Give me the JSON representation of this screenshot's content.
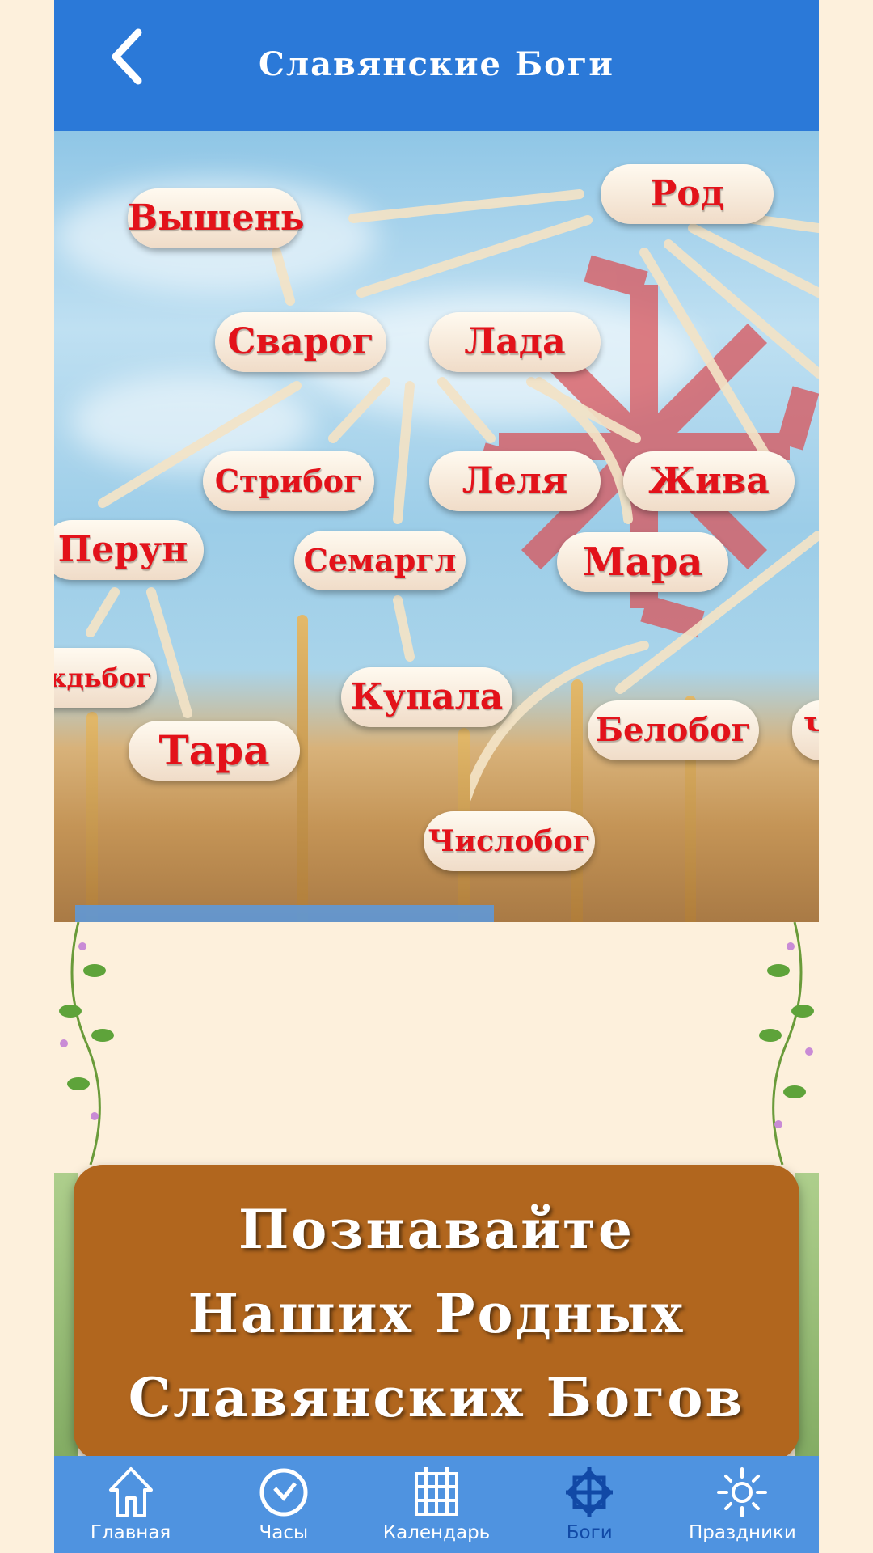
{
  "header": {
    "title": "Славянские Боги",
    "back_icon": "chevron-left-icon"
  },
  "gods": [
    {
      "id": "vyshen",
      "label": "Вышень"
    },
    {
      "id": "rod",
      "label": "Род"
    },
    {
      "id": "svarog",
      "label": "Сварог"
    },
    {
      "id": "lada",
      "label": "Лада"
    },
    {
      "id": "stribog",
      "label": "Стрибог"
    },
    {
      "id": "lelya",
      "label": "Леля"
    },
    {
      "id": "zhiva",
      "label": "Жива"
    },
    {
      "id": "perun",
      "label": "Перун"
    },
    {
      "id": "semargl",
      "label": "Семаргл"
    },
    {
      "id": "mara",
      "label": "Мара"
    },
    {
      "id": "dazhdbog",
      "label": "ждьбог"
    },
    {
      "id": "kupala",
      "label": "Купала"
    },
    {
      "id": "tara",
      "label": "Тара"
    },
    {
      "id": "belobog",
      "label": "Белобог"
    },
    {
      "id": "cut",
      "label": "Ч"
    },
    {
      "id": "chislobog",
      "label": "Числобог"
    }
  ],
  "banner": {
    "lines": [
      "Познавайте",
      "Наших Родных",
      "Славянских Богов"
    ]
  },
  "nav": {
    "items": [
      {
        "label": "Главная",
        "icon": "home-icon"
      },
      {
        "label": "Часы",
        "icon": "clock-icon"
      },
      {
        "label": "Календарь",
        "icon": "calendar-icon"
      },
      {
        "label": "Боги",
        "icon": "slavic-star-icon",
        "active": true
      },
      {
        "label": "Праздники",
        "icon": "sun-icon"
      }
    ]
  },
  "colors": {
    "header": "#2b79d8",
    "nav": "#4f93e0",
    "nav_active": "#1149a6",
    "banner": "#b1661e",
    "god_text": "#e3121a",
    "background": "#fdf0dc"
  }
}
